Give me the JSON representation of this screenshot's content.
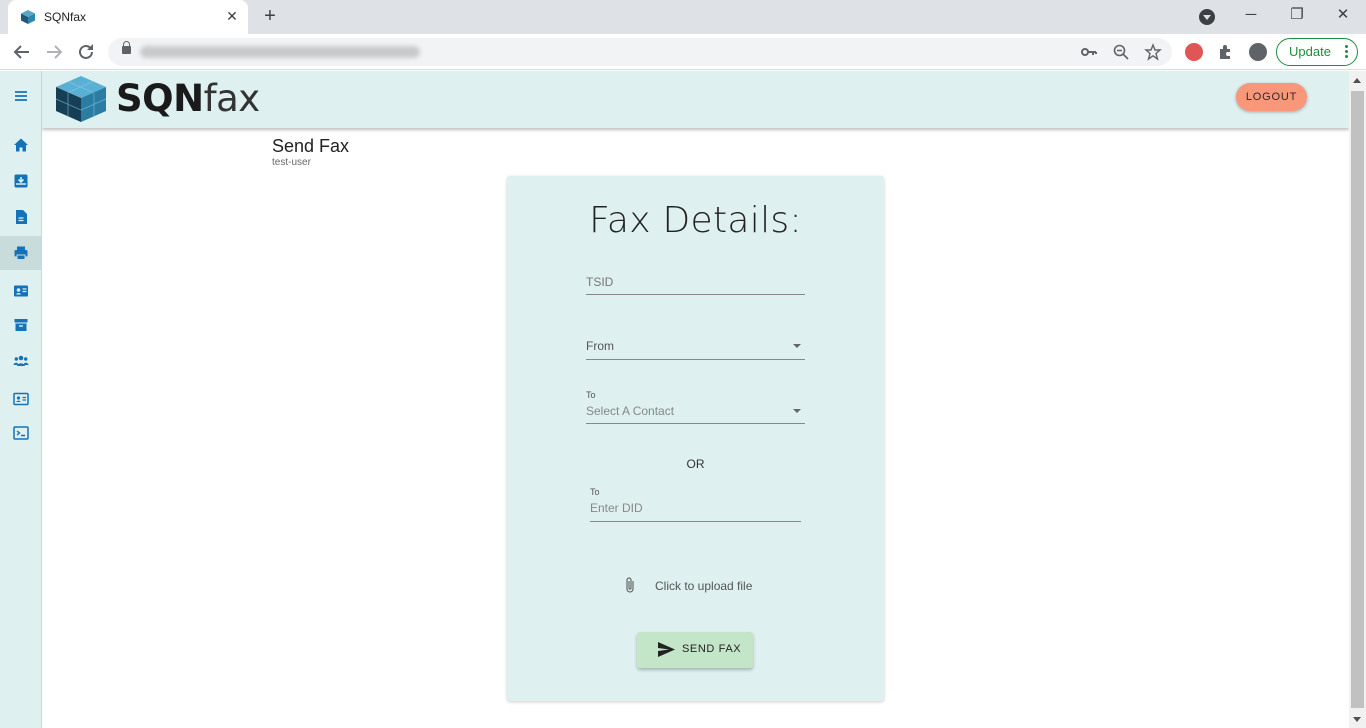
{
  "browser": {
    "tab_title": "SQNfax",
    "tab_close": "✕",
    "new_tab": "+",
    "update_label": "Update",
    "window_controls": {
      "minimize": "─",
      "maximize": "❐",
      "close": "✕"
    }
  },
  "header": {
    "logo_bold": "SQN",
    "logo_light": "fax",
    "logout_label": "LOGOUT"
  },
  "sidebar": {
    "items": [
      {
        "icon": "menu-icon"
      },
      {
        "icon": "home-icon"
      },
      {
        "icon": "inbox-icon"
      },
      {
        "icon": "document-icon"
      },
      {
        "icon": "fax-icon",
        "active": true
      },
      {
        "icon": "contacts-icon"
      },
      {
        "icon": "archive-icon"
      },
      {
        "icon": "users-icon"
      },
      {
        "icon": "id-card-icon"
      },
      {
        "icon": "terminal-icon"
      }
    ]
  },
  "page": {
    "title": "Send Fax",
    "subtitle": "test-user"
  },
  "form": {
    "title": "Fax Details:",
    "tsid_placeholder": "TSID",
    "from_label": "From",
    "to_contact_label": "To",
    "to_contact_placeholder": "Select A Contact",
    "or_text": "OR",
    "to_did_label": "To",
    "to_did_placeholder": "Enter DID",
    "upload_text": "Click to upload file",
    "send_label": "SEND FAX"
  },
  "colors": {
    "sidebar_bg": "#def0f0",
    "card_bg": "#def0f0",
    "logout_bg": "#f9977a",
    "send_bg": "#c4e6c8",
    "icon_blue": "#1472b8"
  }
}
